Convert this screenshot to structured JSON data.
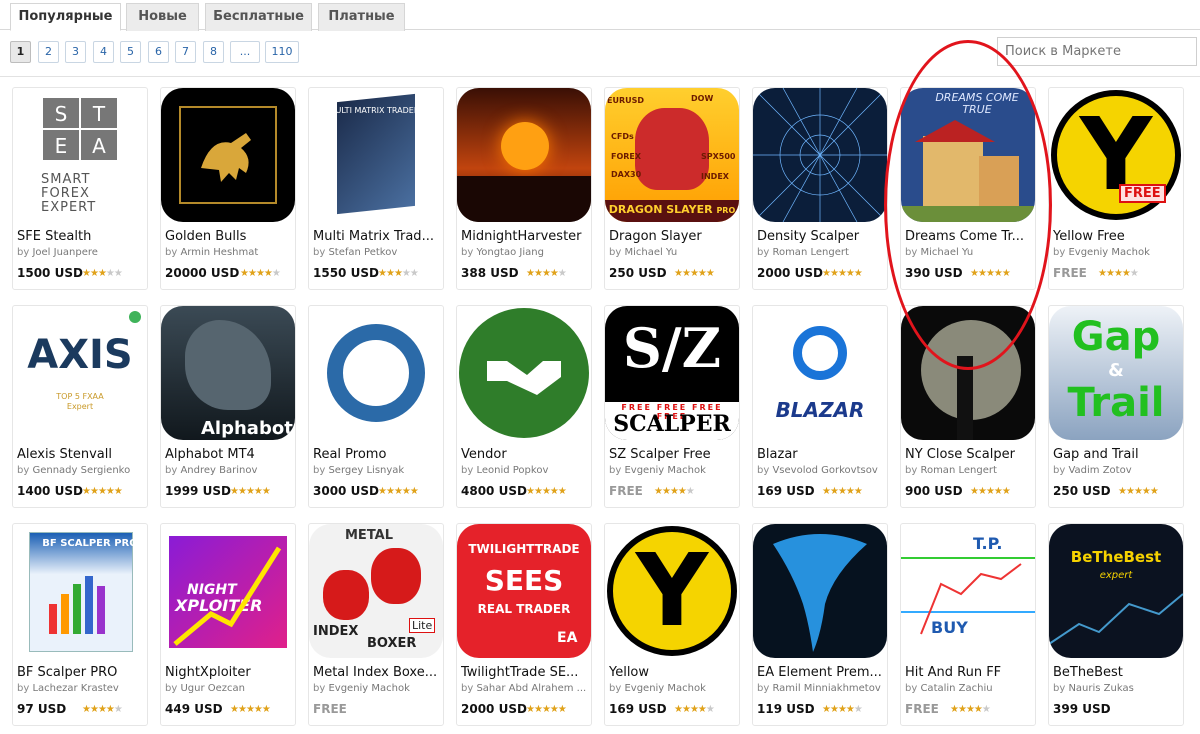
{
  "tabs": [
    {
      "label": "Популярные",
      "active": true
    },
    {
      "label": "Новые",
      "active": false
    },
    {
      "label": "Бесплатные",
      "active": false
    },
    {
      "label": "Платные",
      "active": false
    }
  ],
  "pager": {
    "pages": [
      "1",
      "2",
      "3",
      "4",
      "5",
      "6",
      "7",
      "8",
      "...",
      "110"
    ],
    "current": "1"
  },
  "search": {
    "placeholder": "Поиск в Маркете"
  },
  "products": [
    {
      "name": "SFE Stealth",
      "author": "Joel Juanpere",
      "price": "1500 USD",
      "rating": 3,
      "free": false,
      "icon": "sfe-logo-icon"
    },
    {
      "name": "Golden Bulls",
      "author": "Armin Heshmat",
      "price": "20000 USD",
      "rating": 4,
      "free": false,
      "icon": "golden-bull-icon"
    },
    {
      "name": "Multi Matrix Trad...",
      "author": "Stefan Petkov",
      "price": "1550 USD",
      "rating": 3,
      "free": false,
      "icon": "multi-matrix-box-icon"
    },
    {
      "name": "MidnightHarvester",
      "author": "Yongtao Jiang",
      "price": "388 USD",
      "rating": 4,
      "free": false,
      "icon": "sunset-icon"
    },
    {
      "name": "Dragon Slayer",
      "author": "Michael Yu",
      "price": "250 USD",
      "rating": 5,
      "free": false,
      "icon": "dragon-icon"
    },
    {
      "name": "Density Scalper",
      "author": "Roman Lengert",
      "price": "2000 USD",
      "rating": 5,
      "free": false,
      "icon": "density-grid-icon"
    },
    {
      "name": "Dreams Come Tr...",
      "author": "Michael Yu",
      "price": "390 USD",
      "rating": 5,
      "free": false,
      "icon": "dream-house-icon"
    },
    {
      "name": "Yellow Free",
      "author": "Evgeniy Machok",
      "price": "FREE",
      "rating": 4,
      "free": true,
      "icon": "yellow-y-free-icon"
    },
    {
      "name": "Alexis Stenvall",
      "author": "Gennady Sergienko",
      "price": "1400 USD",
      "rating": 5,
      "free": false,
      "icon": "axis-logo-icon"
    },
    {
      "name": "Alphabot MT4",
      "author": "Andrey Barinov",
      "price": "1999 USD",
      "rating": 5,
      "free": false,
      "icon": "alphabot-horse-icon"
    },
    {
      "name": "Real Promo",
      "author": "Sergey Lisnyak",
      "price": "3000 USD",
      "rating": 5,
      "free": false,
      "icon": "blue-ring-icon"
    },
    {
      "name": "Vendor",
      "author": "Leonid Popkov",
      "price": "4800 USD",
      "rating": 5,
      "free": false,
      "icon": "handshake-icon"
    },
    {
      "name": "SZ Scalper Free",
      "author": "Evgeniy Machok",
      "price": "FREE",
      "rating": 4,
      "free": true,
      "icon": "sz-scalper-icon"
    },
    {
      "name": "Blazar",
      "author": "Vsevolod Gorkovtsov",
      "price": "169 USD",
      "rating": 5,
      "free": false,
      "icon": "blazar-logo-icon"
    },
    {
      "name": "NY Close Scalper",
      "author": "Roman Lengert",
      "price": "900 USD",
      "rating": 5,
      "free": false,
      "icon": "liberty-moon-icon"
    },
    {
      "name": "Gap and Trail",
      "author": "Vadim Zotov",
      "price": "250 USD",
      "rating": 5,
      "free": false,
      "icon": "gap-trail-icon"
    },
    {
      "name": "BF Scalper PRO",
      "author": "Lachezar Krastev",
      "price": "97 USD",
      "rating": 4,
      "free": false,
      "icon": "bf-scalper-box-icon"
    },
    {
      "name": "NightXploiter",
      "author": "Ugur Oezcan",
      "price": "449 USD",
      "rating": 5,
      "free": false,
      "icon": "night-xploiter-icon"
    },
    {
      "name": "Metal Index Boxe...",
      "author": "Evgeniy Machok",
      "price": "FREE",
      "rating": 0,
      "free": true,
      "icon": "boxing-gloves-icon"
    },
    {
      "name": "TwilightTrade SE...",
      "author": "Sahar Abd Alrahem ...",
      "price": "2000 USD",
      "rating": 5,
      "free": false,
      "icon": "twilight-sees-icon"
    },
    {
      "name": "Yellow",
      "author": "Evgeniy Machok",
      "price": "169 USD",
      "rating": 4,
      "free": false,
      "icon": "yellow-y-icon"
    },
    {
      "name": "EA Element Prem...",
      "author": "Ramil Minniakhmetov",
      "price": "119 USD",
      "rating": 4,
      "free": false,
      "icon": "tornado-icon"
    },
    {
      "name": "Hit And Run FF",
      "author": "Catalin Zachiu",
      "price": "FREE",
      "rating": 4,
      "free": true,
      "icon": "buy-chart-icon"
    },
    {
      "name": "BeTheBest",
      "author": "Nauris Zukas",
      "price": "399 USD",
      "rating": 0,
      "free": false,
      "icon": "bethebest-icon"
    }
  ],
  "labels": {
    "by": "by"
  },
  "icon_text": {
    "sfe_letters": [
      "S",
      "T",
      "E",
      "A"
    ],
    "sfe_words": "SMART FOREX EXPERT",
    "multi_matrix": "MULTI MATRIX TRADER",
    "dragon_title": "DRAGON SLAYER",
    "dragon_pro": "PRO",
    "dragon_tags": [
      "EURUSD",
      "DOW",
      "CFDs",
      "FOREX",
      "SPX500",
      "DAX30",
      "INDEX"
    ],
    "dreams": "DREAMS COME TRUE",
    "y": "Y",
    "free_tag": "FREE",
    "axis": "AXIS",
    "axis_sub": "TOP 5 FXAA Expert",
    "alphabot": "Alphabot",
    "sz": "S/Z",
    "scalper": "SCALPER",
    "free_row": "FREE FREE FREE FREE",
    "blazar": "BLAZAR",
    "gap": "Gap",
    "amp": "&",
    "trail": "Trail",
    "bf": "BF SCALPER PRO",
    "night": "NIGHT",
    "xploiter": "XPLOITER",
    "metal": "METAL",
    "index": "INDEX",
    "boxer": "BOXER",
    "lite": "Lite",
    "twilighttrade": "TWILIGHTTRADE",
    "sees": "SEES",
    "real_trader": "REAL TRADER",
    "ea": "EA",
    "tp": "T.P.",
    "buy": "BUY",
    "bethebest": "BeTheBest",
    "expert": "expert"
  },
  "colors": {
    "accent": "#2a65a8",
    "star": "#e0a21a",
    "highlight": "#e1141c"
  }
}
